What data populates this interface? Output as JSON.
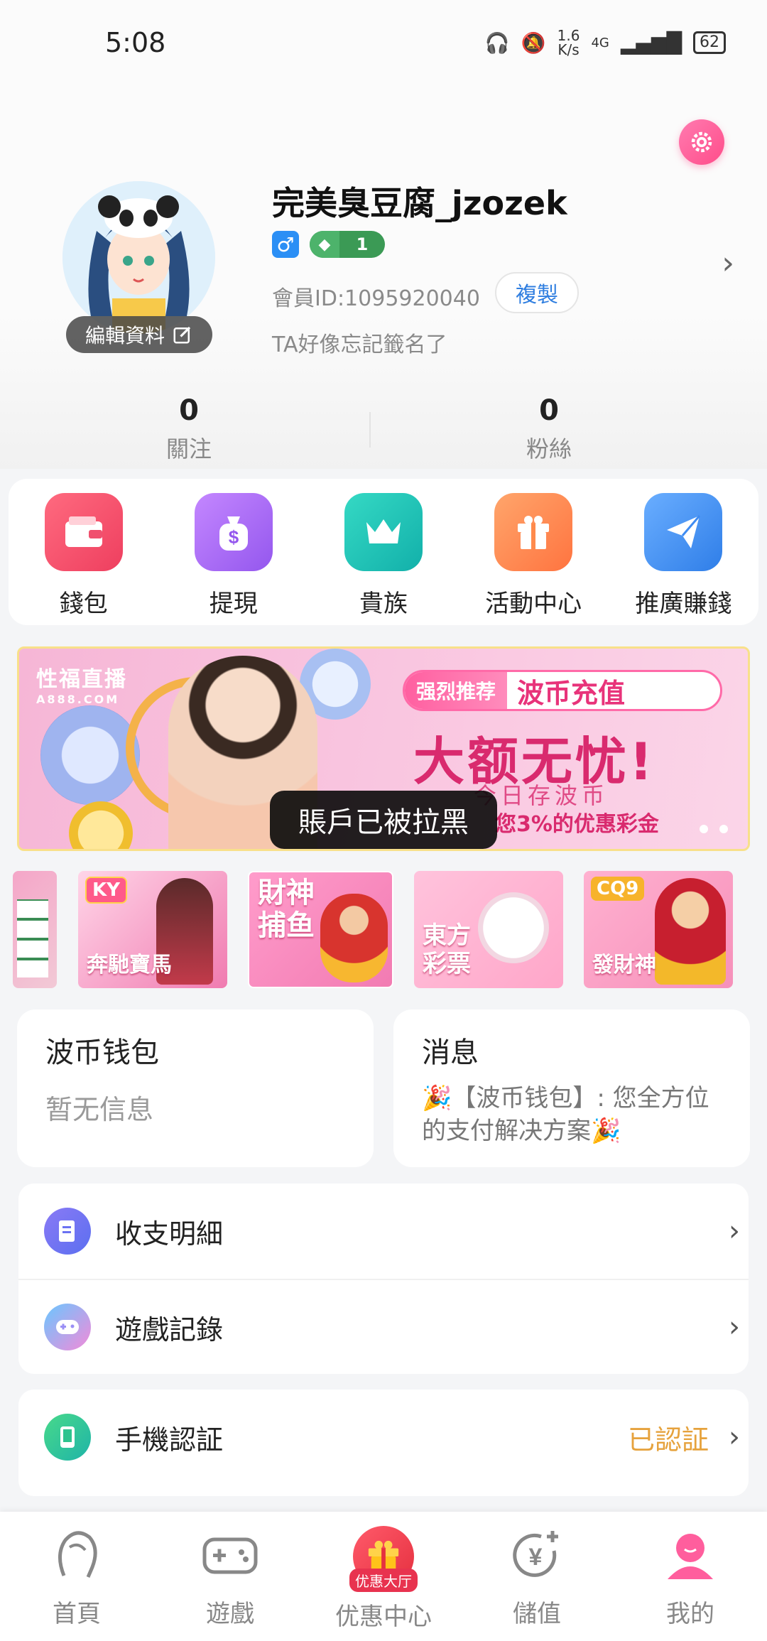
{
  "status_bar": {
    "time": "5:08",
    "net_speed_top": "1.6",
    "net_speed_unit": "K/s",
    "signal": "4G",
    "battery": "62"
  },
  "profile": {
    "nickname": "完美臭豆腐_jzozek",
    "gender_symbol": "♂",
    "level": "1",
    "member_id": "會員ID:1095920040",
    "copy_label": "複製",
    "signature": "TA好像忘記籤名了",
    "edit_label": "編輯資料",
    "following_count": "0",
    "following_label": "關注",
    "fans_count": "0",
    "fans_label": "粉絲"
  },
  "quick_actions": [
    {
      "label": "錢包",
      "icon": "wallet-icon",
      "color": "#f0506e"
    },
    {
      "label": "提現",
      "icon": "money-bag-icon",
      "color": "#a66bf0"
    },
    {
      "label": "貴族",
      "icon": "crown-icon",
      "color": "#1fc4b4"
    },
    {
      "label": "活動中心",
      "icon": "gift-icon",
      "color": "#ff8a4c"
    },
    {
      "label": "推廣賺錢",
      "icon": "paper-plane-icon",
      "color": "#3f8cf2"
    }
  ],
  "banner": {
    "brand": "性福直播",
    "brand_sub": "A888.COM",
    "tag_left": "强烈推荐",
    "tag_right": "波币充值",
    "headline": "大额无忧!",
    "sub1": "今日存波币",
    "sub2": "您3%的优惠彩金"
  },
  "toast": "賬戶已被拉黑",
  "games": [
    {
      "label": "",
      "badge": ""
    },
    {
      "label": "奔馳寶馬",
      "badge": "KY"
    },
    {
      "label": "財神\n捕鱼",
      "badge": ""
    },
    {
      "label": "東方\n彩票",
      "badge": ""
    },
    {
      "label": "發財神",
      "badge": "CQ9"
    }
  ],
  "wallet_card": {
    "title": "波币钱包",
    "body": "暂无信息"
  },
  "message_card": {
    "title": "消息",
    "body": "🎉【波币钱包】: 您全方位的支付解决方案🎉"
  },
  "menu_group_1": [
    {
      "label": "收支明細",
      "icon": "document-icon"
    },
    {
      "label": "遊戲記錄",
      "icon": "gamepad-icon"
    }
  ],
  "menu_group_2": [
    {
      "label": "手機認証",
      "icon": "phone-icon",
      "status": "已認証"
    }
  ],
  "bottom_nav": [
    {
      "label": "首頁",
      "icon": "home-icon"
    },
    {
      "label": "遊戲",
      "icon": "gamepad-icon"
    },
    {
      "label": "优惠中心",
      "icon": "gift-icon",
      "badge": "优惠大厅"
    },
    {
      "label": "儲值",
      "icon": "yen-plus-icon"
    },
    {
      "label": "我的",
      "icon": "profile-icon"
    }
  ]
}
